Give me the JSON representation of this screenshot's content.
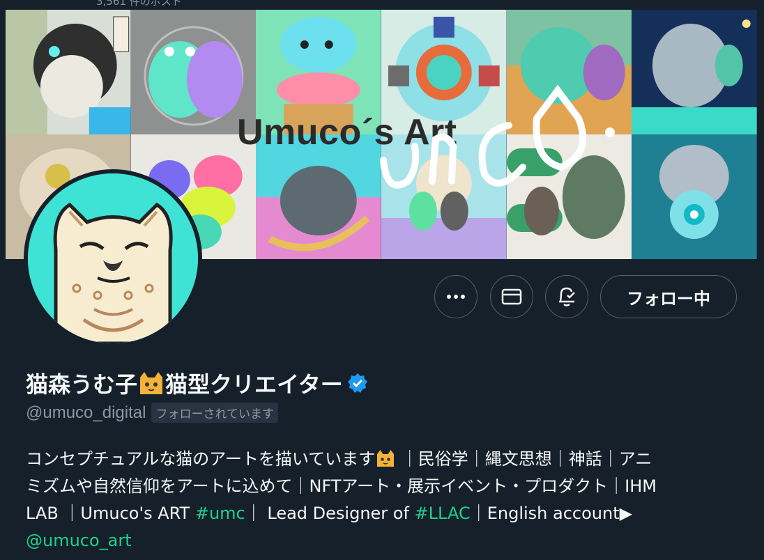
{
  "top_strip": {
    "text": "3,561 件のポスト"
  },
  "banner": {
    "title": "Umuco´s Art",
    "signature": "umco."
  },
  "profile": {
    "display_name_part1": "猫森うむ子",
    "display_name_part2": "猫型クリエイター",
    "handle": "@umuco_digital",
    "follows_you_badge": "フォローされています",
    "verified": true
  },
  "actions": {
    "more_icon": "more-icon",
    "message_icon": "mail-icon",
    "notify_icon": "bell-check-icon",
    "follow_label": "フォロー中"
  },
  "bio": {
    "line1": "コンセプチュアルな猫のアートを描いています",
    "line1_tail": " ｜民俗学｜縄文思想｜神話｜アニ",
    "line2": "ミズムや自然信仰をアートに込めて｜NFTアート・展示イベント・プロダクト｜IHM",
    "line3_a": "LAB ｜Umuco's ART ",
    "hashtag1": "#umc",
    "line3_b": "｜ Lead Designer of ",
    "hashtag2": "#LLAC",
    "line3_c": "｜English account▶",
    "mention": "@umuco_art"
  },
  "colors": {
    "background": "#15202b",
    "link": "#1fd18b",
    "verified": "#1d9bf0",
    "muted": "#8b98a5"
  }
}
